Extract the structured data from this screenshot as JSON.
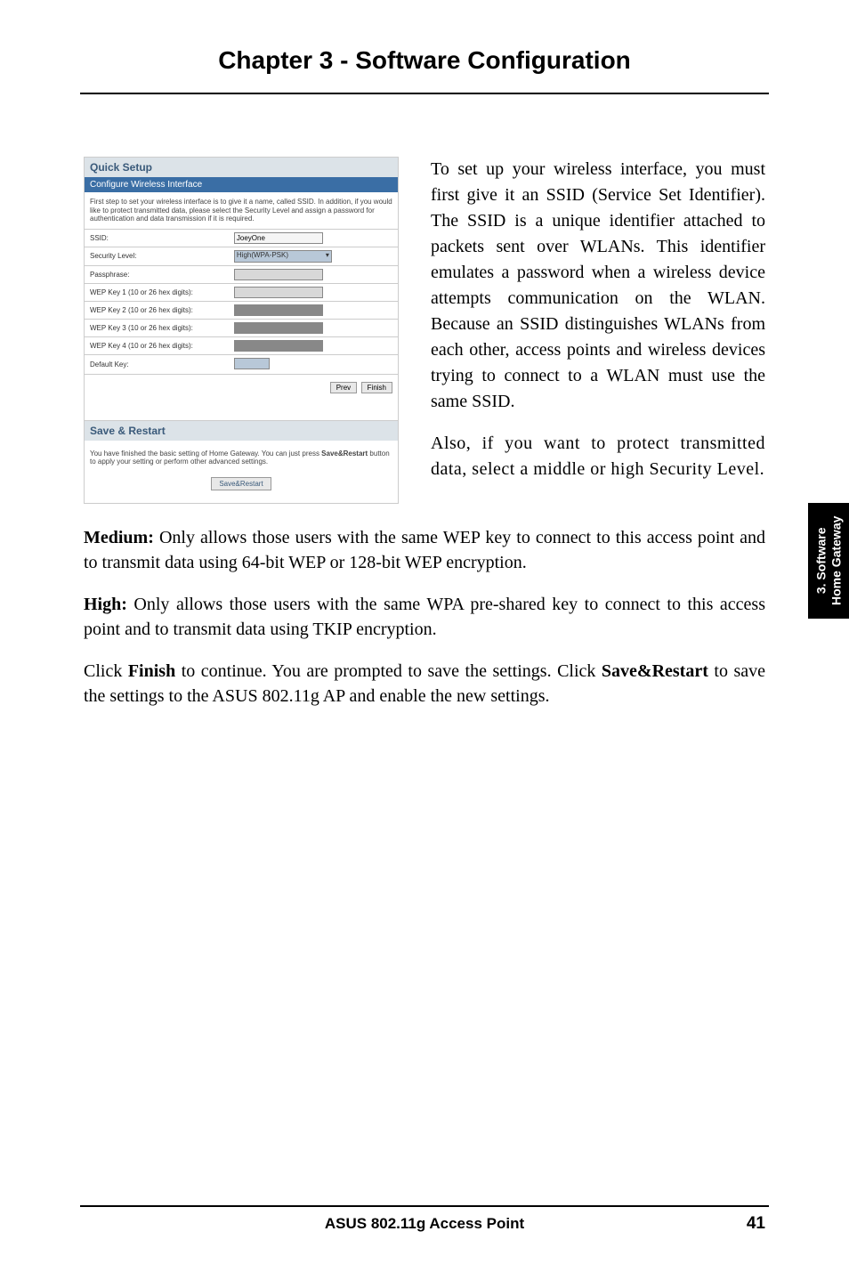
{
  "header": {
    "title": "Chapter 3 - Software Configuration"
  },
  "screenshot": {
    "quick_setup_title": "Quick Setup",
    "configure_title": "Configure Wireless Interface",
    "intro_text": "First step to set your wireless interface is to give it a name, called SSID. In addition, if you would like to protect transmitted data, please select the Security Level and assign a password for authentication and data transmission if it is required.",
    "rows": {
      "ssid_label": "SSID:",
      "ssid_value": "JoeyOne",
      "security_label": "Security Level:",
      "security_value": "High(WPA-PSK)",
      "passphrase_label": "Passphrase:",
      "wep1_label": "WEP Key 1 (10 or 26 hex digits):",
      "wep2_label": "WEP Key 2 (10 or 26 hex digits):",
      "wep3_label": "WEP Key 3 (10 or 26 hex digits):",
      "wep4_label": "WEP Key 4 (10 or 26 hex digits):",
      "default_key_label": "Default Key:"
    },
    "buttons": {
      "prev": "Prev",
      "finish": "Finish"
    },
    "save_restart_title": "Save & Restart",
    "save_restart_text": "You have finished the basic setting of Home Gateway. You can just press Save&Restart button to apply your setting or perform other advanced settings.",
    "save_restart_btn": "Save&Restart"
  },
  "main_text": {
    "para1": "To set up your wireless interface, you must first give it an SSID (Service Set Identifier). The SSID is a unique identifier attached to packets sent over WLANs. This identifier emulates a password when a wireless device attempts communication on the WLAN. Because an SSID distinguishes WLANs from each other, access points and wireless devices trying to connect to a WLAN must use the same SSID.",
    "para2": "Also, if you want to protect transmitted data, select a middle or high Security Level.",
    "medium_bold": "Medium:",
    "medium_text": " Only allows those users with the same WEP key to connect to this access point and to transmit data using 64-bit WEP or 128-bit WEP encryption.",
    "high_bold": "High:",
    "high_text": " Only allows those users with the same WPA pre-shared key to connect to this access point and to transmit data using TKIP encryption.",
    "finish_pre": "Click ",
    "finish_bold": "Finish",
    "finish_mid": " to continue. You are prompted to save the settings. Click ",
    "sr_bold": "Save&Restart",
    "finish_post": " to save the settings to the ASUS 802.11g AP and enable the new settings."
  },
  "side_tab": {
    "line1": "3. Software",
    "line2": "Home Gateway"
  },
  "footer": {
    "product": "ASUS 802.11g Access Point",
    "page": "41"
  }
}
